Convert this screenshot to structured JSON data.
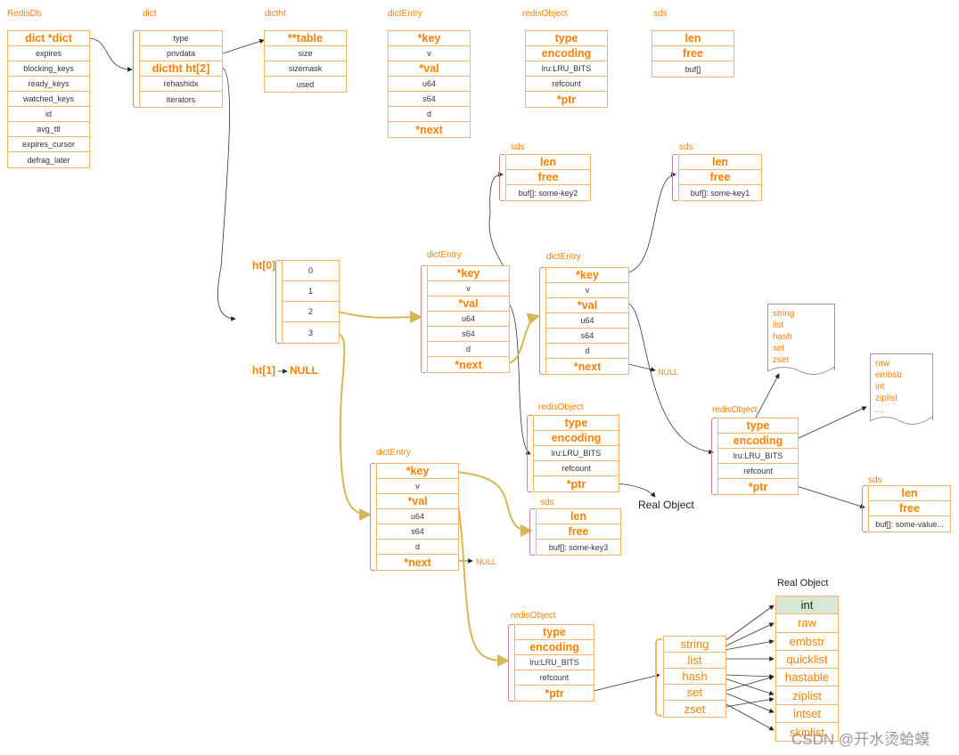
{
  "boxes": {
    "redisdb": {
      "label": "RedisDb",
      "rows": [
        "dict  *dict",
        "expires",
        "blocking_keys",
        "ready_keys",
        "watched_keys",
        "id",
        "avg_ttl",
        "expires_cursor",
        "defrag_later"
      ]
    },
    "dict": {
      "label": "dict",
      "rows": [
        "type",
        "privdata",
        "dictht ht[2]",
        "rehashidx",
        "iterators"
      ]
    },
    "dictht": {
      "label": "dictht",
      "rows": [
        "**table",
        "size",
        "sizemask",
        "used"
      ]
    },
    "dictentry": {
      "label": "dictEntry",
      "rows": [
        "*key",
        "v",
        "*val",
        "u64",
        "s64",
        "d",
        "*next"
      ]
    },
    "redisobject": {
      "label": "redisObject",
      "rows": [
        "type",
        "encoding",
        "lru:LRU_BITS",
        "refcount",
        "*ptr"
      ]
    },
    "sds": {
      "label": "sds",
      "rows": [
        "len",
        "free",
        "buf[]"
      ]
    },
    "sds_key2": {
      "label": "sds",
      "rows": [
        "len",
        "free",
        "buf[]: some-key2"
      ]
    },
    "sds_key1": {
      "label": "sds",
      "rows": [
        "len",
        "free",
        "buf[]: some-key1"
      ]
    },
    "table": {
      "label": "ht[0]",
      "rows": [
        "0",
        "1",
        "2",
        "3"
      ]
    },
    "entry_a": {
      "label": "dictEntry",
      "rows": [
        "*key",
        "v",
        "*val",
        "u64",
        "s64",
        "d",
        "*next"
      ]
    },
    "entry_b": {
      "label": "dictEntry",
      "rows": [
        "*key",
        "v",
        "*val",
        "u64",
        "s64",
        "d",
        "*next"
      ]
    },
    "obj_c": {
      "label": "redisObject",
      "rows": [
        "type",
        "encoding",
        "lru:LRU_BITS",
        "refcount",
        "*ptr"
      ]
    },
    "sds_value": {
      "label": "sds",
      "rows": [
        "len",
        "free",
        "buf[]: some-value..."
      ]
    },
    "obj_e": {
      "label": "redisObject",
      "rows": [
        "type",
        "encoding",
        "lru:LRU_BITS",
        "refcount",
        "*ptr"
      ]
    },
    "entry_f": {
      "label": "dictEntry",
      "rows": [
        "*key",
        "v",
        "*val",
        "u64",
        "s64",
        "d",
        "*next"
      ]
    },
    "sds_key3": {
      "label": "sds",
      "rows": [
        "len",
        "free",
        "buf[]: some-key3"
      ]
    },
    "obj_h": {
      "label": "redisObject",
      "rows": [
        "type",
        "encoding",
        "lru:LRU_BITS",
        "refcount",
        "*ptr"
      ]
    },
    "types": {
      "label": "",
      "rows": [
        "string",
        "list",
        "hash",
        "set",
        "zset"
      ]
    },
    "real": {
      "label": "Real Object",
      "rows": [
        "int",
        "raw",
        "embstr",
        "quicklist",
        "hastable",
        "ziplist",
        "intset",
        "skiplist"
      ]
    }
  },
  "ht1_null": "ht[1]",
  "null_label": "NULL",
  "real_object_label": "Real Object",
  "type_list": [
    "string",
    "list",
    "hash",
    "set",
    "zset"
  ],
  "encoding_list": [
    "raw",
    "embstr",
    "int",
    "ziplist",
    "...."
  ],
  "watermark": "CSDN @开水烫蛤蟆",
  "colors": {
    "accent": "#ff8000",
    "border": "#ffb366",
    "link_gold": "#d6b656",
    "highlight": "#d5e8d4"
  }
}
